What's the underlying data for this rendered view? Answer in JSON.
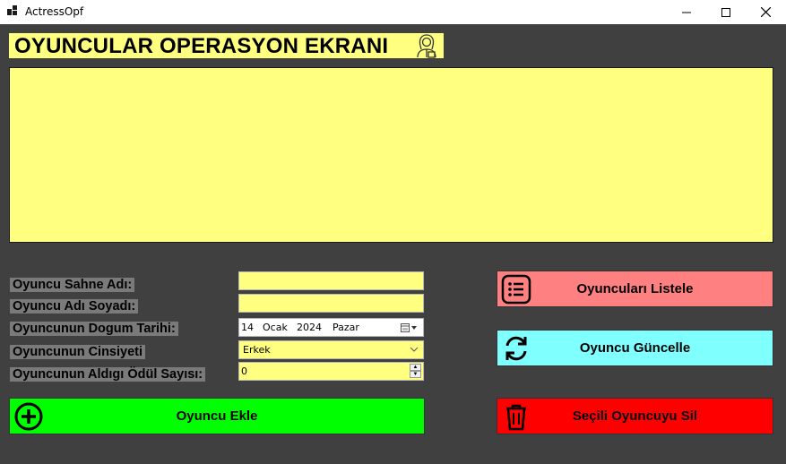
{
  "window": {
    "title": "ActressOpf",
    "icons": [
      "app-icon",
      "minimize-icon",
      "maximize-icon",
      "close-icon"
    ]
  },
  "header": {
    "title": "OYUNCULAR OPERASYON EKRANI",
    "icon": "actress-icon"
  },
  "colors": {
    "background": "#404040",
    "field_yellow": "#ffff80",
    "list_button": "#ff8080",
    "update_button": "#80ffff",
    "add_button": "#00ff00",
    "delete_button": "#ff0000"
  },
  "form": {
    "stage_name_label": "Oyuncu Sahne Adı:",
    "stage_name_value": "",
    "full_name_label": "Oyuncu Adı Soyadı:",
    "full_name_value": "",
    "birth_date_label": "Oyuncunun Dogum Tarihi:",
    "birth_date": {
      "day": "14",
      "month": "Ocak",
      "year": "2024",
      "weekday": "Pazar"
    },
    "gender_label": "Oyuncunun Cinsiyeti",
    "gender_value": "Erkek",
    "awards_label": "Oyuncunun Aldıgı Ödül Sayısı:",
    "awards_value": "0"
  },
  "buttons": {
    "list": "Oyuncuları Listele",
    "update": "Oyuncu Güncelle",
    "add": "Oyuncu Ekle",
    "delete": "Seçili Oyuncuyu Sil"
  }
}
